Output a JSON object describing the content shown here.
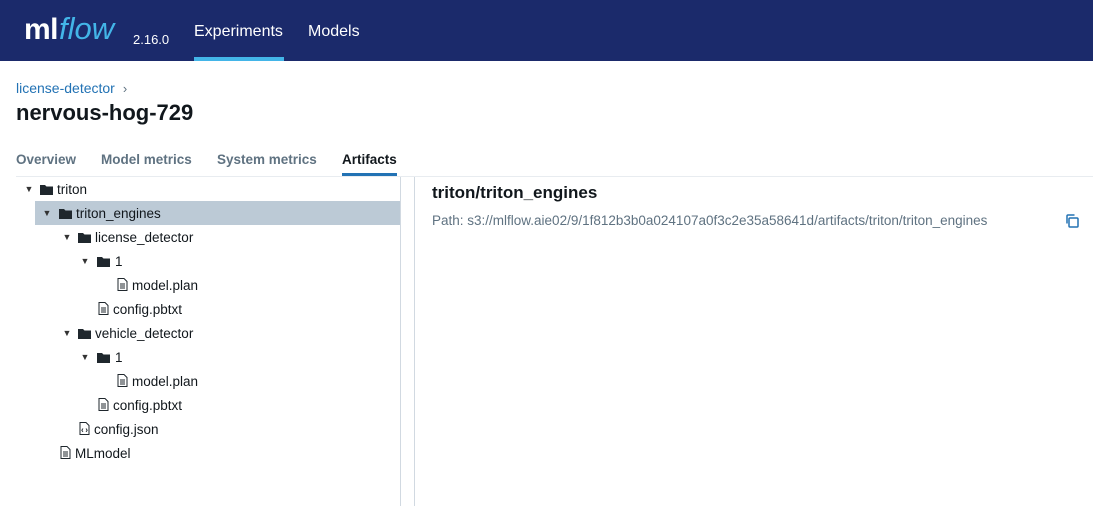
{
  "header": {
    "logo_ml": "ml",
    "logo_flow": "flow",
    "version": "2.16.0",
    "nav": [
      {
        "label": "Experiments",
        "active": true
      },
      {
        "label": "Models",
        "active": false
      }
    ],
    "colors": {
      "background": "#1b2a6b",
      "accent": "#43b5e8"
    }
  },
  "breadcrumb": {
    "experiment": "license-detector",
    "separator": "›"
  },
  "run": {
    "title": "nervous-hog-729"
  },
  "tabs": [
    {
      "label": "Overview",
      "active": false
    },
    {
      "label": "Model metrics",
      "active": false
    },
    {
      "label": "System metrics",
      "active": false
    },
    {
      "label": "Artifacts",
      "active": true
    }
  ],
  "tree": [
    {
      "label": "triton",
      "type": "folder",
      "expanded": true,
      "depth": 0
    },
    {
      "label": "triton_engines",
      "type": "folder",
      "expanded": true,
      "depth": 1,
      "selected": true
    },
    {
      "label": "license_detector",
      "type": "folder",
      "expanded": true,
      "depth": 2
    },
    {
      "label": "1",
      "type": "folder",
      "expanded": true,
      "depth": 3
    },
    {
      "label": "model.plan",
      "type": "file",
      "depth": 4
    },
    {
      "label": "config.pbtxt",
      "type": "file",
      "depth": 3
    },
    {
      "label": "vehicle_detector",
      "type": "folder",
      "expanded": true,
      "depth": 2
    },
    {
      "label": "1",
      "type": "folder",
      "expanded": true,
      "depth": 3
    },
    {
      "label": "model.plan",
      "type": "file",
      "depth": 4
    },
    {
      "label": "config.pbtxt",
      "type": "file",
      "depth": 3
    },
    {
      "label": "config.json",
      "type": "code-file",
      "depth": 2
    },
    {
      "label": "MLmodel",
      "type": "file",
      "depth": 1
    }
  ],
  "artifact": {
    "title": "triton/triton_engines",
    "path": "Path: s3://mlflow.aie02/9/1f812b3b0a024107a0f3c2e35a58641d/artifacts/triton/triton_engines",
    "copy_icon": "copy-icon"
  }
}
